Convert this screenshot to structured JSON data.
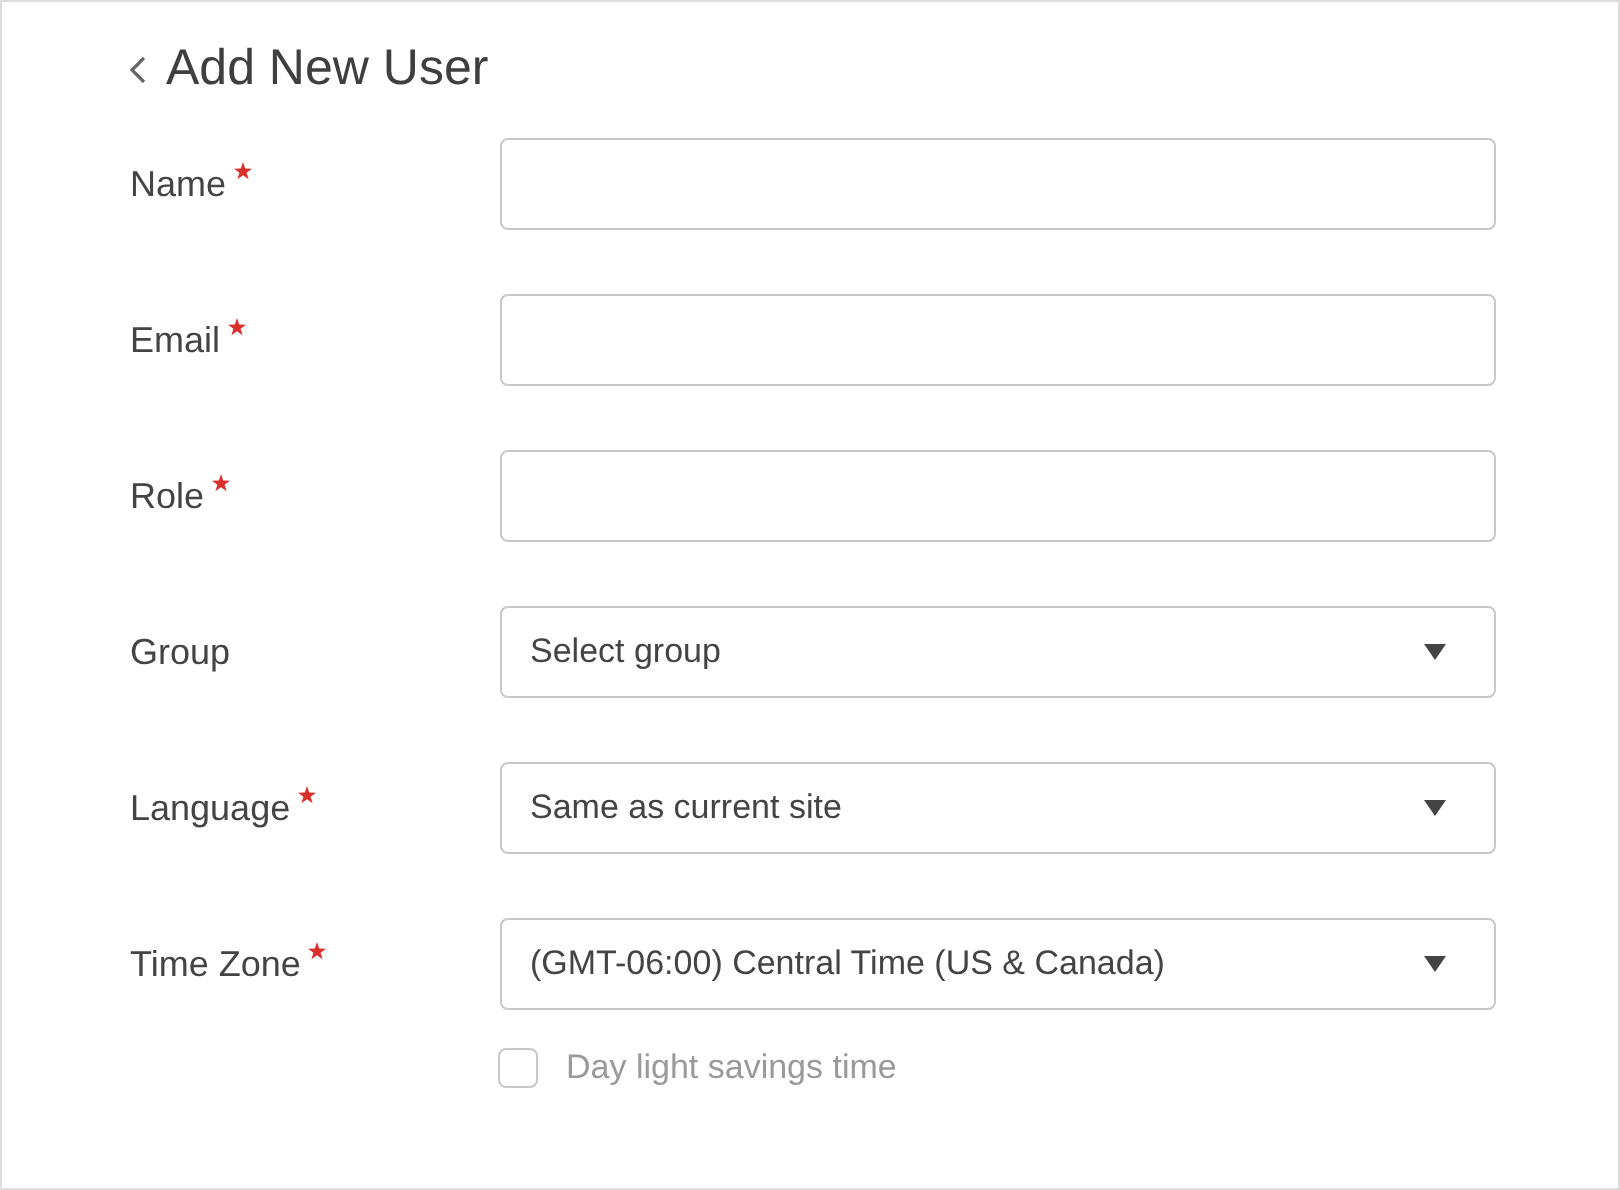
{
  "header": {
    "title": "Add New User"
  },
  "fields": [
    {
      "label": "Name",
      "required": true,
      "kind": "text"
    },
    {
      "label": "Email",
      "required": true,
      "kind": "text"
    },
    {
      "label": "Role",
      "required": true,
      "kind": "text"
    },
    {
      "label": "Group",
      "required": false,
      "kind": "select",
      "value": "Select group"
    },
    {
      "label": "Language",
      "required": true,
      "kind": "select",
      "value": "Same as current site"
    },
    {
      "label": "Time Zone",
      "required": true,
      "kind": "select",
      "value": "(GMT-06:00) Central Time (US & Canada)"
    }
  ],
  "daylight_savings": {
    "label": "Day light savings time",
    "checked": false
  }
}
